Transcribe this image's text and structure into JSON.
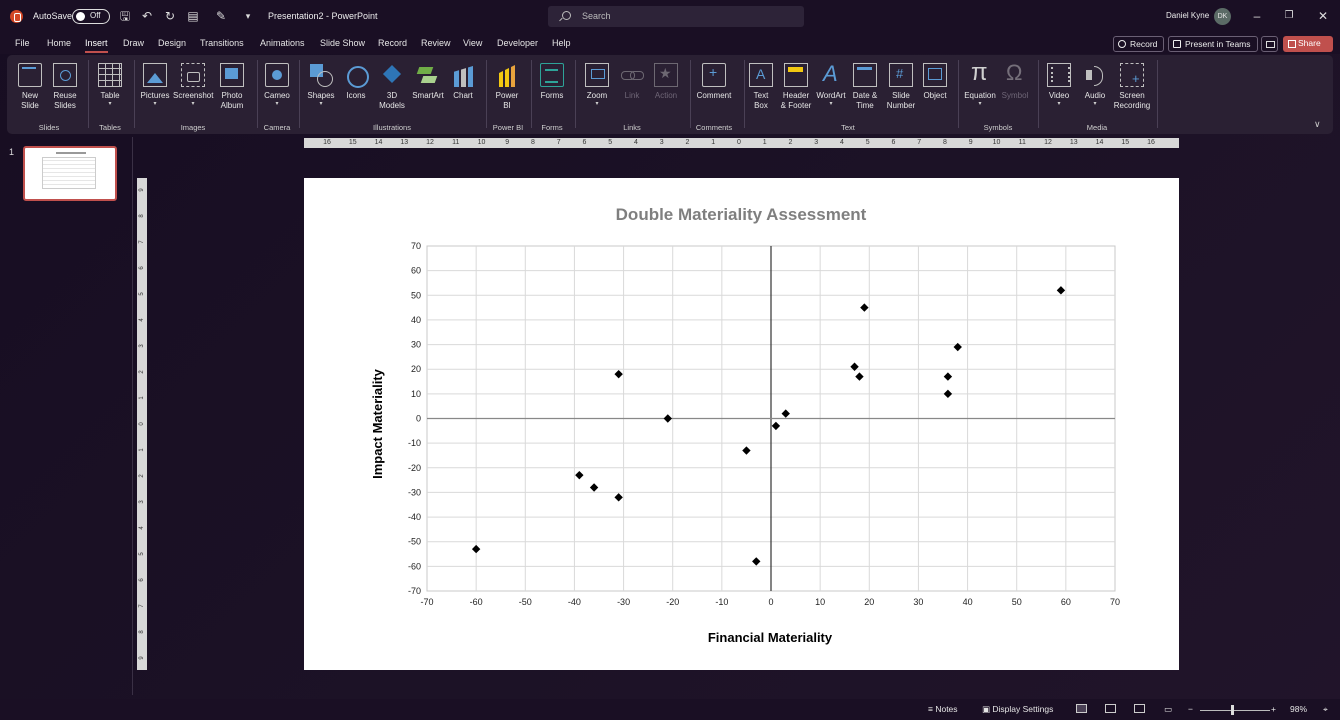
{
  "titlebar": {
    "autosave_label": "AutoSave",
    "autosave_state": "Off",
    "doc_title": "Presentation2  -  PowerPoint",
    "search_placeholder": "Search",
    "user_name": "Daniel Kyne",
    "user_initials": "DK"
  },
  "menu": {
    "tabs": [
      "File",
      "Home",
      "Insert",
      "Draw",
      "Design",
      "Transitions",
      "Animations",
      "Slide Show",
      "Record",
      "Review",
      "View",
      "Developer",
      "Help"
    ],
    "active_tab": "Insert",
    "record_label": "Record",
    "present_label": "Present in Teams",
    "share_label": "Share"
  },
  "ribbon": {
    "groups": {
      "slides": "Slides",
      "tables": "Tables",
      "images": "Images",
      "camera": "Camera",
      "illustrations": "Illustrations",
      "powerbi": "Power BI",
      "forms": "Forms",
      "links": "Links",
      "comments": "Comments",
      "text": "Text",
      "symbols": "Symbols",
      "media": "Media"
    },
    "buttons": {
      "new_slide": "New\nSlide",
      "reuse_slides": "Reuse\nSlides",
      "table": "Table",
      "pictures": "Pictures",
      "screenshot": "Screenshot",
      "photo_album": "Photo\nAlbum",
      "cameo": "Cameo",
      "shapes": "Shapes",
      "icons": "Icons",
      "models_3d": "3D\nModels",
      "smartart": "SmartArt",
      "chart": "Chart",
      "power_bi": "Power\nBI",
      "forms": "Forms",
      "zoom": "Zoom",
      "link": "Link",
      "action": "Action",
      "comment": "Comment",
      "text_box": "Text\nBox",
      "header_footer": "Header\n& Footer",
      "wordart": "WordArt",
      "date_time": "Date &\nTime",
      "slide_number": "Slide\nNumber",
      "object": "Object",
      "equation": "Equation",
      "symbol": "Symbol",
      "video": "Video",
      "audio": "Audio",
      "screen_recording": "Screen\nRecording"
    }
  },
  "thumbnails": {
    "slide_number": "1"
  },
  "rulers": {
    "horizontal": [
      "16",
      "15",
      "14",
      "13",
      "12",
      "11",
      "10",
      "9",
      "8",
      "7",
      "6",
      "5",
      "4",
      "3",
      "2",
      "1",
      "0",
      "1",
      "2",
      "3",
      "4",
      "5",
      "6",
      "7",
      "8",
      "9",
      "10",
      "11",
      "12",
      "13",
      "14",
      "15",
      "16"
    ],
    "vertical": [
      "9",
      "8",
      "7",
      "6",
      "5",
      "4",
      "3",
      "2",
      "1",
      "0",
      "1",
      "2",
      "3",
      "4",
      "5",
      "6",
      "7",
      "8",
      "9"
    ]
  },
  "chart_data": {
    "type": "scatter",
    "title": "Double Materiality Assessment",
    "xlabel": "Financial Materiality",
    "ylabel": "Impact Materiality",
    "xlim": [
      -70,
      70
    ],
    "ylim": [
      -70,
      70
    ],
    "xticks": [
      -70,
      -60,
      -50,
      -40,
      -30,
      -20,
      -10,
      0,
      10,
      20,
      30,
      40,
      50,
      60,
      70
    ],
    "yticks": [
      -70,
      -60,
      -50,
      -40,
      -30,
      -20,
      -10,
      0,
      10,
      20,
      30,
      40,
      50,
      60,
      70
    ],
    "grid": true,
    "marker": "diamond",
    "marker_color": "#000000",
    "points": [
      {
        "x": -60,
        "y": -53
      },
      {
        "x": -39,
        "y": -23
      },
      {
        "x": -36,
        "y": -28
      },
      {
        "x": -31,
        "y": -32
      },
      {
        "x": -31,
        "y": 18
      },
      {
        "x": -21,
        "y": 0
      },
      {
        "x": -5,
        "y": -13
      },
      {
        "x": -3,
        "y": -58
      },
      {
        "x": 1,
        "y": -3
      },
      {
        "x": 3,
        "y": 2
      },
      {
        "x": 17,
        "y": 21
      },
      {
        "x": 18,
        "y": 17
      },
      {
        "x": 19,
        "y": 45
      },
      {
        "x": 36,
        "y": 17
      },
      {
        "x": 36,
        "y": 10
      },
      {
        "x": 38,
        "y": 29
      },
      {
        "x": 59,
        "y": 52
      }
    ]
  },
  "statusbar": {
    "notes_label": "Notes",
    "display_settings_label": "Display Settings",
    "zoom_level": "98%"
  },
  "colors": {
    "accent": "#c0504d",
    "title_bar": "#1a0f24",
    "ribbon": "#2a2033"
  }
}
